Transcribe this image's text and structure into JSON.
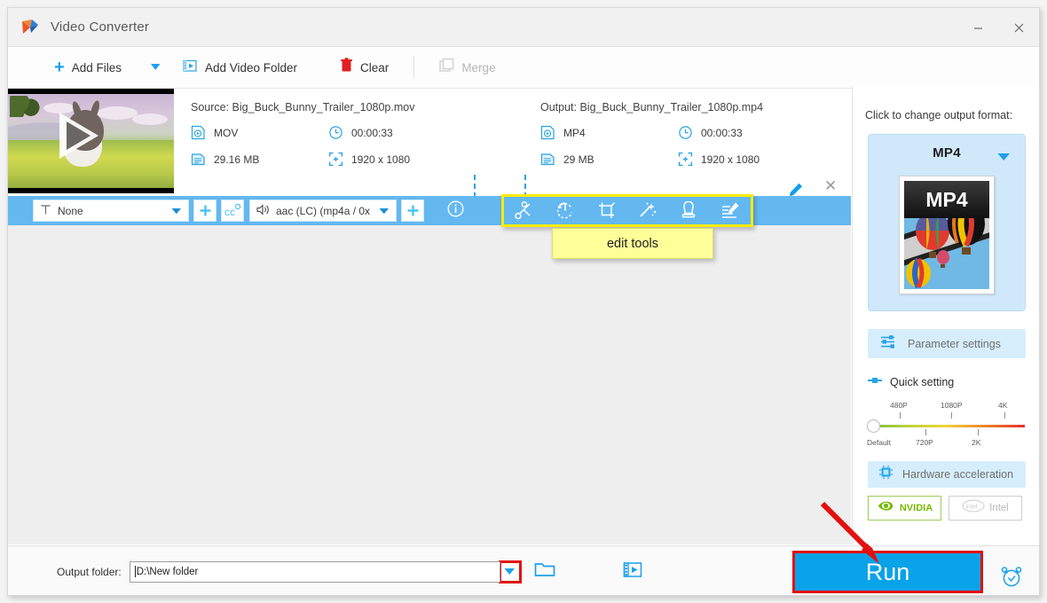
{
  "window": {
    "title": "Video Converter",
    "minimize": "–",
    "close": "✕"
  },
  "toolbar": {
    "add_files": "Add Files",
    "add_video_folder": "Add Video Folder",
    "clear": "Clear",
    "merge": "Merge"
  },
  "file": {
    "source_label": "Source: Big_Buck_Bunny_Trailer_1080p.mov",
    "source_format": "MOV",
    "source_duration": "00:00:33",
    "source_size": "29.16 MB",
    "source_resolution": "1920 x 1080",
    "output_label": "Output: Big_Buck_Bunny_Trailer_1080p.mp4",
    "output_format": "MP4",
    "output_duration": "00:00:33",
    "output_size": "29 MB",
    "output_resolution": "1920 x 1080"
  },
  "settings_bar": {
    "subtitle_value": "None",
    "subtitle_add": "+",
    "cc_label": "cc",
    "audio_value": "aac (LC) (mp4a / 0x",
    "audio_add": "+",
    "info": "i"
  },
  "edit_tools": {
    "callout": "edit tools",
    "tools": [
      {
        "name": "cut-icon"
      },
      {
        "name": "rotate-icon"
      },
      {
        "name": "crop-icon"
      },
      {
        "name": "effect-icon"
      },
      {
        "name": "watermark-icon"
      },
      {
        "name": "subtitle-edit-icon"
      }
    ]
  },
  "right_panel": {
    "format_prompt": "Click to change output format:",
    "format_name": "MP4",
    "thumb_text": "MP4",
    "parameter_settings": "Parameter settings",
    "quick_setting": "Quick setting",
    "slider": {
      "top_ticks": [
        "480P",
        "1080P",
        "4K"
      ],
      "bottom_ticks": [
        "Default",
        "720P",
        "2K"
      ],
      "value": "Default"
    },
    "hardware_acceleration": "Hardware acceleration",
    "gpu_nvidia": "NVIDIA",
    "gpu_intel": "Intel"
  },
  "bottom": {
    "output_folder_label": "Output folder:",
    "output_folder_value": "D:\\New folder",
    "run": "Run"
  },
  "colors": {
    "accent_blue": "#0aa2e8",
    "bar_blue": "#63b8f0",
    "highlight_yellow": "#ffeb00",
    "callout_yellow": "#ffff99",
    "marker_red": "#e31010",
    "nvidia_green": "#76b900"
  }
}
